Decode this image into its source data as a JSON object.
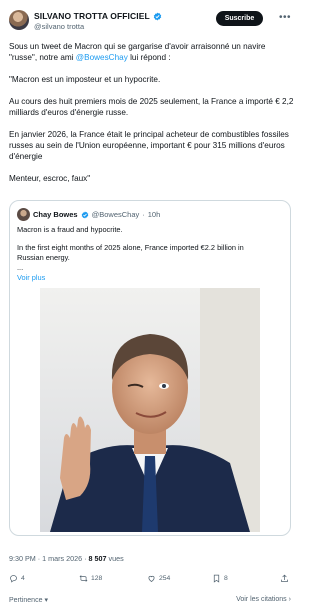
{
  "author": {
    "name": "SILVANO TROTTA OFFICIEL",
    "handle": "@silvano trotta",
    "subscribe_label": "Suscribe",
    "more_label": "•••"
  },
  "post": {
    "paragraphs": [
      {
        "pre": "Sous un tweet de Macron qui se gargarise d'avoir arraisonné un navire \"russe\", notre ami ",
        "mention": "@BowesChay",
        "post": " lui répond :"
      },
      {
        "pre": "\"Macron est un imposteur et un hypocrite.",
        "mention": "",
        "post": ""
      },
      {
        "pre": "Au cours des huit premiers mois de 2025 seulement, la France a importé € 2,2 milliards d'euros d'énergie russe.",
        "mention": "",
        "post": ""
      },
      {
        "pre": "En janvier 2026, la France était le principal acheteur de combustibles fossiles russes au sein de l'Union européenne, important € pour 315 millions d'euros d'énergie",
        "mention": "",
        "post": ""
      },
      {
        "pre": "Menteur, escroc, faux\"",
        "mention": "",
        "post": ""
      }
    ]
  },
  "quote": {
    "name": "Chay Bowes",
    "handle": "@BowesChay",
    "dot": "·",
    "time": "10h",
    "line1": "Macron is a fraud and hypocrite.",
    "line2": "In the first eight months of 2025 alone, France imported €2.2 billion in",
    "line3": "Russian energy.",
    "line4": "...",
    "voir_plus": "Voir plus"
  },
  "meta": {
    "time_date": "9:30 PM · 1 mars 2026 · ",
    "views_count": "8 507",
    "views_label": " vues"
  },
  "actions": {
    "replies": "4",
    "reposts": "128",
    "likes": "254",
    "bookmarks": "8"
  },
  "footer": {
    "relevance": "Pertinence",
    "citations": "Voir les citations"
  },
  "colors": {
    "accent": "#1d9bf0",
    "text": "#0f1419",
    "muted": "#536471",
    "border": "#cfd9de"
  }
}
